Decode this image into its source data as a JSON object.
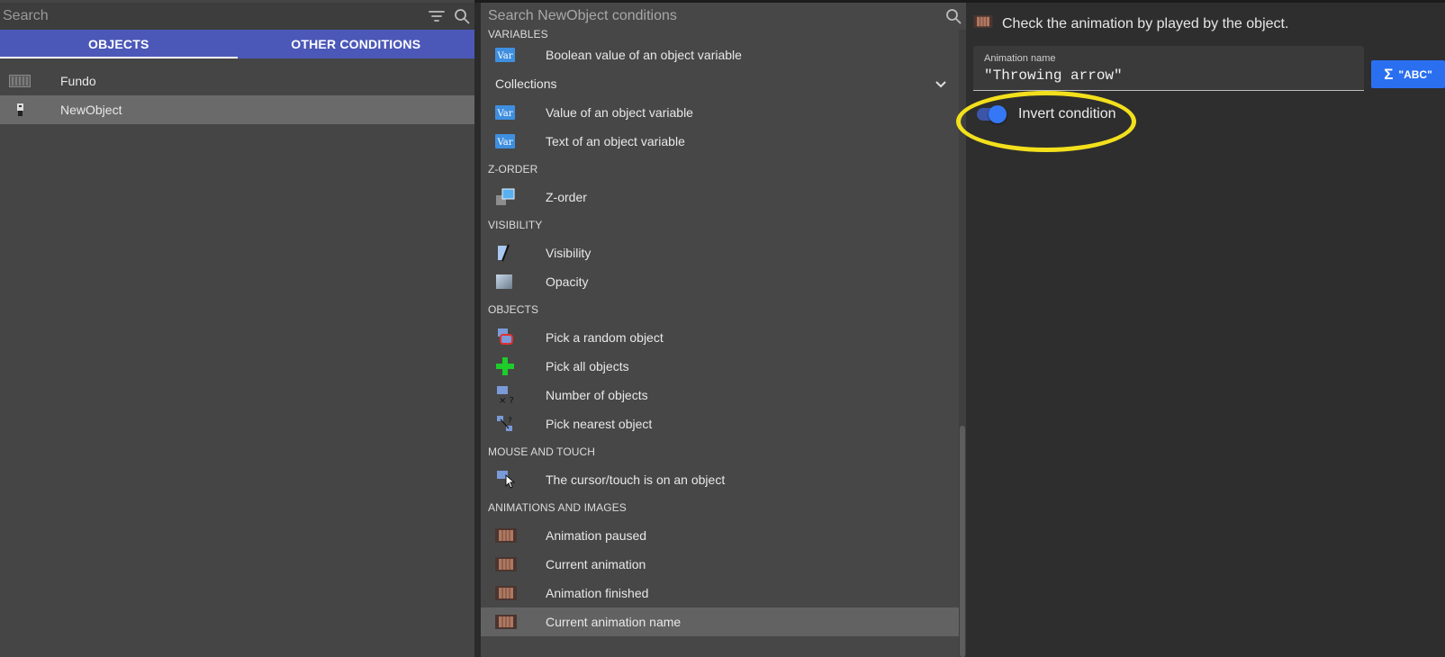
{
  "left_panel": {
    "search_placeholder": "Search",
    "tabs": [
      {
        "label": "OBJECTS",
        "active": true
      },
      {
        "label": "OTHER CONDITIONS",
        "active": false
      }
    ],
    "objects": [
      {
        "name": "Fundo",
        "icon": "tiled-sprite-icon",
        "selected": false
      },
      {
        "name": "NewObject",
        "icon": "sprite-icon",
        "selected": true
      }
    ]
  },
  "conditions_panel": {
    "search_placeholder": "Search NewObject conditions",
    "sections": {
      "variables": "VARIABLES",
      "z_order": "Z-ORDER",
      "visibility": "VISIBILITY",
      "objects": "OBJECTS",
      "mouse_touch": "MOUSE AND TOUCH",
      "animations": "ANIMATIONS AND IMAGES"
    },
    "var_icon_text": "Var",
    "items": {
      "boolean_var": "Boolean value of an object variable",
      "collections": "Collections",
      "value_var": "Value of an object variable",
      "text_var": "Text of an object variable",
      "z_order": "Z-order",
      "visibility": "Visibility",
      "opacity": "Opacity",
      "pick_random": "Pick a random object",
      "pick_all": "Pick all objects",
      "number_objects": "Number of objects",
      "pick_nearest": "Pick nearest object",
      "cursor_on_object": "The cursor/touch is on an object",
      "animation_paused": "Animation paused",
      "current_animation": "Current animation",
      "animation_finished": "Animation finished",
      "current_animation_name": "Current animation name"
    }
  },
  "parameters_panel": {
    "description": "Check the animation by played by the object.",
    "animation_name_label": "Animation name",
    "animation_name_value": "\"Throwing arrow\"",
    "expression_button": {
      "sigma": "Σ",
      "label": "\"ABC\""
    },
    "invert_condition_label": "Invert condition",
    "invert_condition_on": true
  },
  "colors": {
    "tab_bar": "#4c58b8",
    "toggle_on": "#3478f6",
    "highlight_ring": "#f3e01c",
    "expression_button": "#2a6ff0"
  }
}
